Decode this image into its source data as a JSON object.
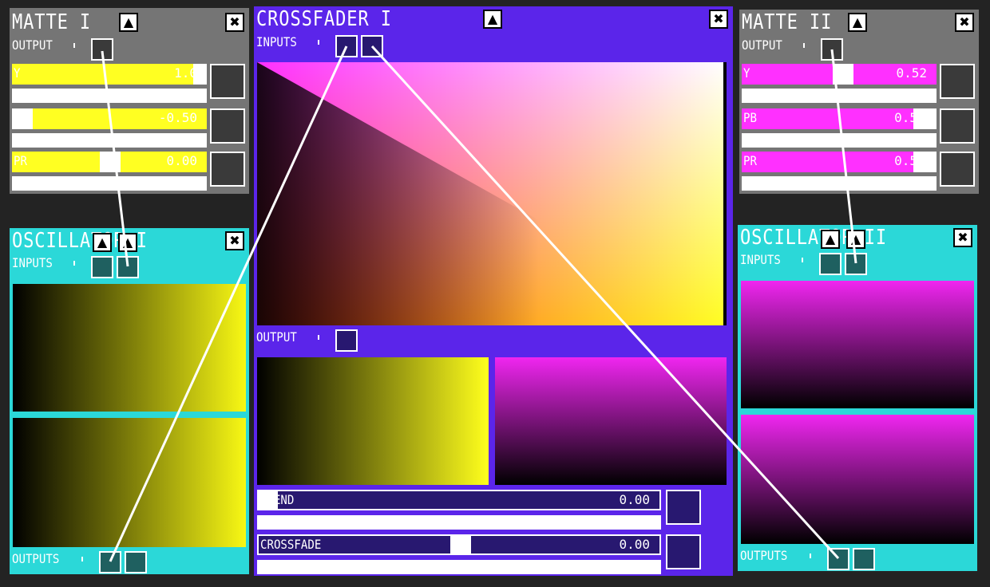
{
  "colors": {
    "background": "#232323",
    "matte_bg": "#757575",
    "osc_bg": "#2bd8d8",
    "cross_bg": "#5b25ea",
    "yellow": "#ffff22",
    "magenta": "#ff30ff",
    "dark_port": "#1f6060",
    "dark_box": "#3a3a3a",
    "navy": "#281870"
  },
  "matte1": {
    "title": "MATTE I",
    "output_label": "OUTPUT",
    "sliders": [
      {
        "label": "Y",
        "value": "1.0",
        "level": 0.93
      },
      {
        "label": "",
        "value": "-0.50",
        "level": 0.11
      },
      {
        "label": "PR",
        "value": "0.00",
        "level": 0.5
      }
    ]
  },
  "matte2": {
    "title": "MATTE II",
    "output_label": "OUTPUT",
    "sliders": [
      {
        "label": "Y",
        "value": "0.52",
        "level": 0.55
      },
      {
        "label": "PB",
        "value": "0.5",
        "level": 0.88
      },
      {
        "label": "PR",
        "value": "0.5",
        "level": 0.88
      }
    ]
  },
  "osc1": {
    "title": "OSCILLATOR I",
    "inputs_label": "INPUTS",
    "outputs_label": "OUTPUTS"
  },
  "osc2": {
    "title": "OSCILLATOR II",
    "inputs_label": "INPUTS",
    "outputs_label": "OUTPUTS"
  },
  "cross": {
    "title": "CROSSFADER I",
    "inputs_label": "INPUTS",
    "output_label": "OUTPUT",
    "sliders": [
      {
        "label": "BLEND",
        "value": "0.00",
        "level": 0.0
      },
      {
        "label": "CROSSFADE",
        "value": "0.00",
        "level": 0.5
      }
    ]
  },
  "icons": {
    "collapse": "chevron-up-icon",
    "close": "close-icon"
  },
  "glyphs": {
    "collapse": "▲",
    "close": "✖"
  }
}
